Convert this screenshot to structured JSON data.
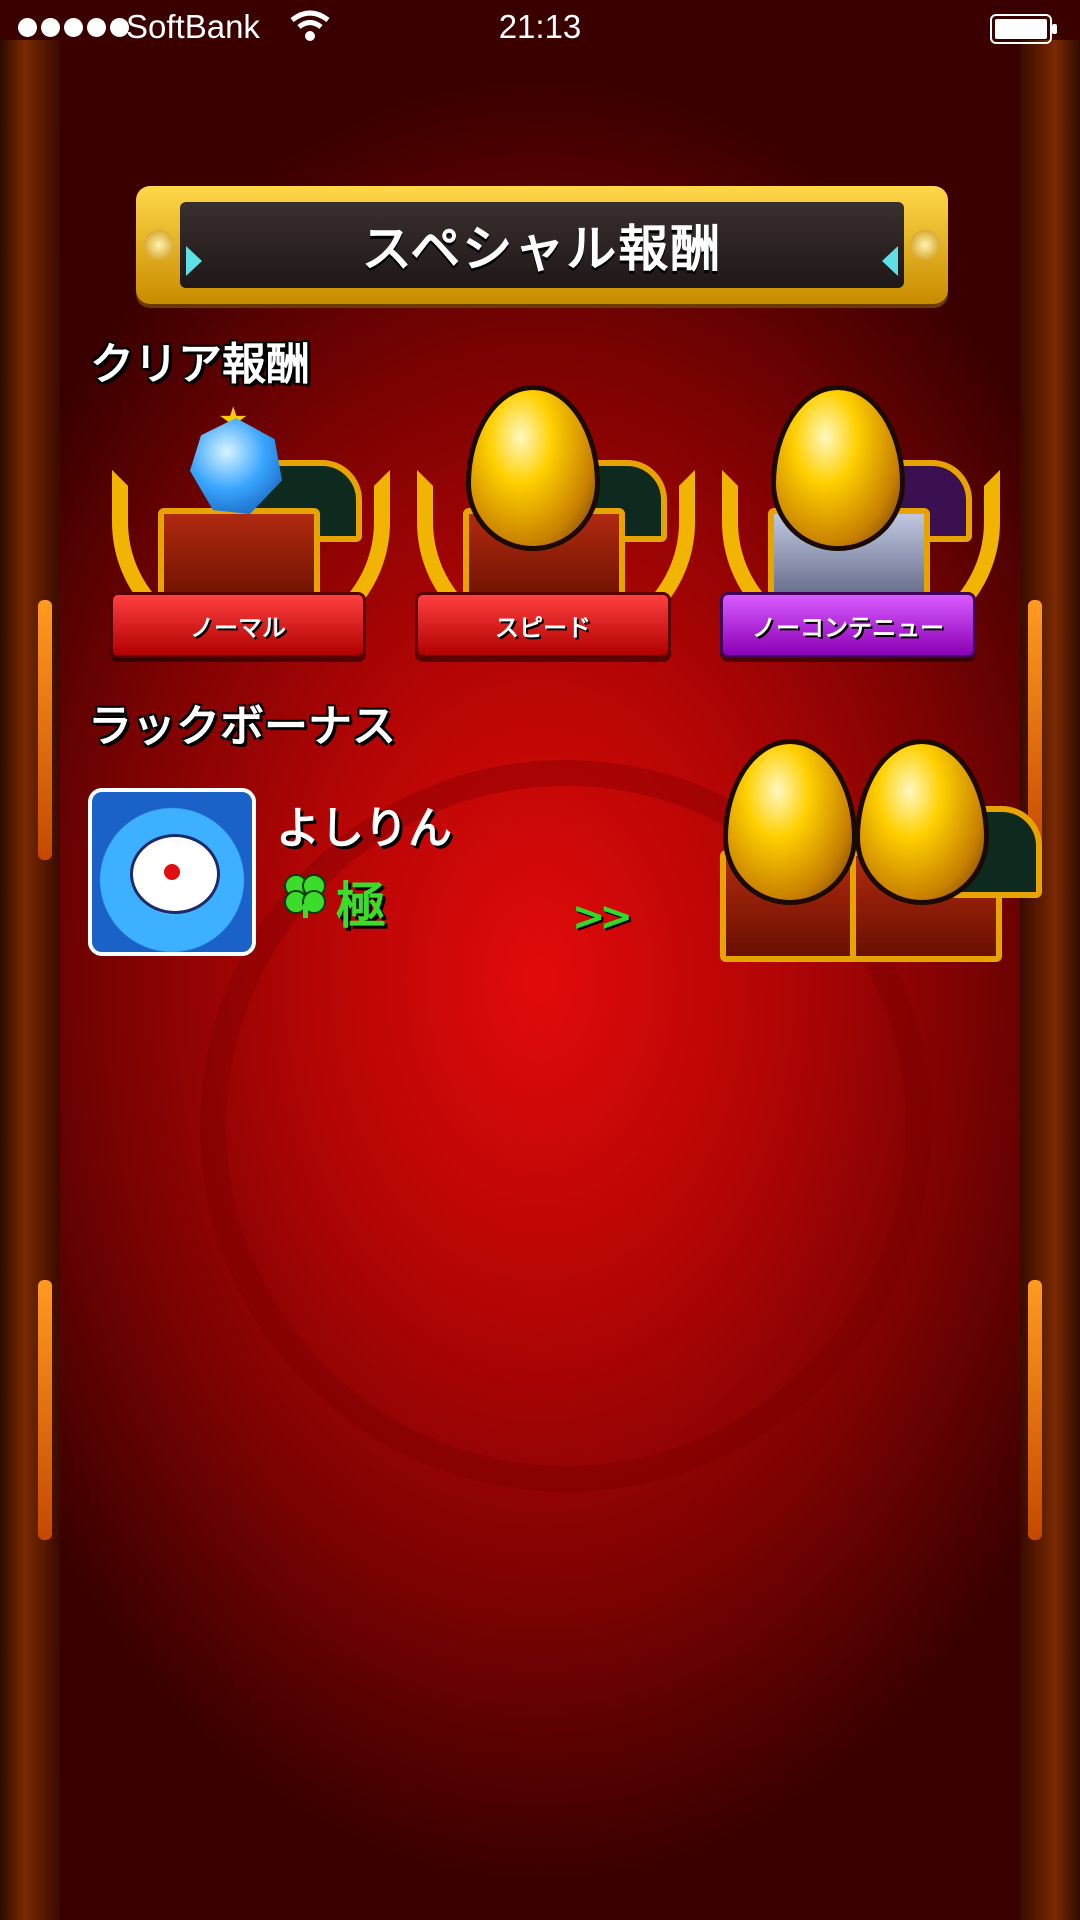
{
  "status_bar": {
    "carrier": "SoftBank",
    "time": "21:13"
  },
  "title": "スペシャル報酬",
  "clear_reward": {
    "heading": "クリア報酬",
    "items": [
      {
        "label": "ノーマル",
        "reward": "gem",
        "ribbon_color": "#d40000"
      },
      {
        "label": "スピード",
        "reward": "golden-egg",
        "ribbon_color": "#d40000"
      },
      {
        "label": "ノーコンテニュー",
        "reward": "golden-egg",
        "ribbon_color": "#b100e0"
      }
    ]
  },
  "luck_bonus": {
    "heading": "ラックボーナス",
    "player_name": "よしりん",
    "luck_level": "極",
    "reward": "golden-egg-x2"
  },
  "colors": {
    "background": "#c40606",
    "title_frame": "#f4c21a",
    "luck_text": "#3cdc2a"
  }
}
